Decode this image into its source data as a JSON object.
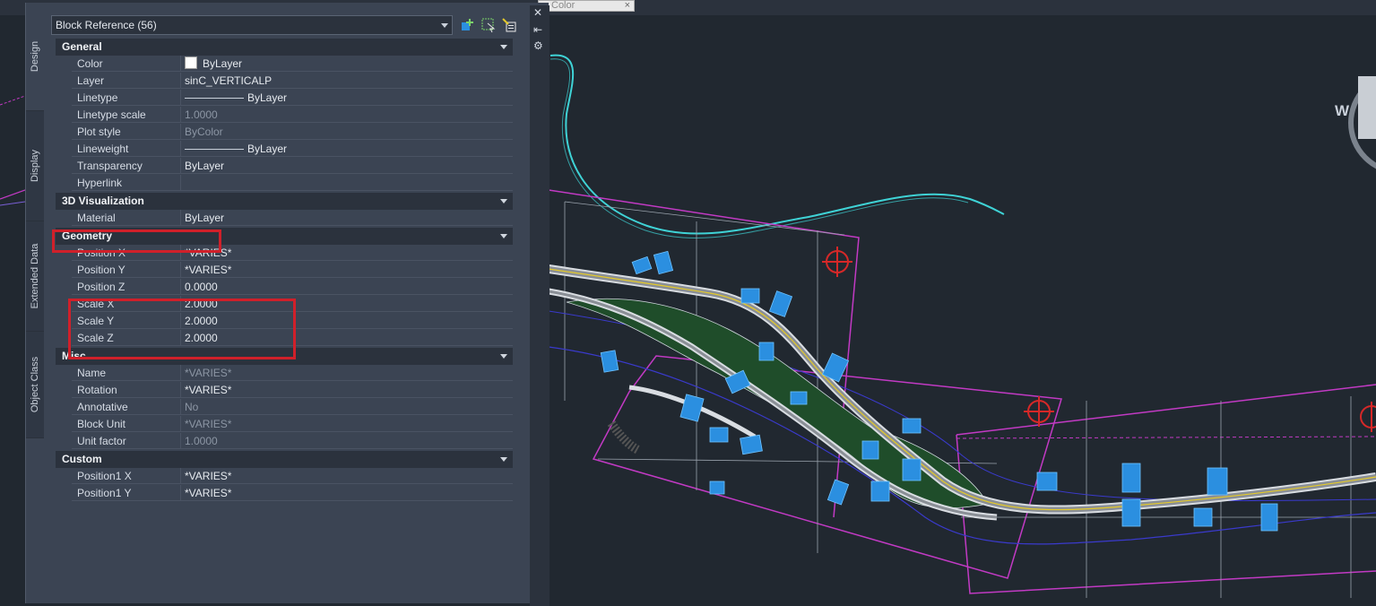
{
  "top": {
    "field_text": "Color",
    "field_clear": "×"
  },
  "palette": {
    "selection": "Block Reference (56)",
    "tabs": [
      "Design",
      "Display",
      "Extended Data",
      "Object Class"
    ],
    "side_buttons": [
      "✕",
      "⇤",
      "⚙"
    ],
    "sections": [
      {
        "title": "General",
        "rows": [
          {
            "name": "Color",
            "value": "ByLayer"
          },
          {
            "name": "Layer",
            "value": "sinC_VERTICALP"
          },
          {
            "name": "Linetype",
            "value": "ByLayer"
          },
          {
            "name": "Linetype scale",
            "value": "1.0000"
          },
          {
            "name": "Plot style",
            "value": "ByColor"
          },
          {
            "name": "Lineweight",
            "value": "ByLayer"
          },
          {
            "name": "Transparency",
            "value": "ByLayer"
          },
          {
            "name": "Hyperlink",
            "value": ""
          }
        ]
      },
      {
        "title": "3D Visualization",
        "rows": [
          {
            "name": "Material",
            "value": "ByLayer"
          }
        ]
      },
      {
        "title": "Geometry",
        "rows": [
          {
            "name": "Position X",
            "value": "*VARIES*"
          },
          {
            "name": "Position Y",
            "value": "*VARIES*"
          },
          {
            "name": "Position Z",
            "value": "0.0000"
          },
          {
            "name": "Scale X",
            "value": "2.0000"
          },
          {
            "name": "Scale Y",
            "value": "2.0000"
          },
          {
            "name": "Scale Z",
            "value": "2.0000"
          }
        ]
      },
      {
        "title": "Misc",
        "rows": [
          {
            "name": "Name",
            "value": "*VARIES*"
          },
          {
            "name": "Rotation",
            "value": "*VARIES*"
          },
          {
            "name": "Annotative",
            "value": "No"
          },
          {
            "name": "Block Unit",
            "value": "*VARIES*"
          },
          {
            "name": "Unit factor",
            "value": "1.0000"
          }
        ]
      },
      {
        "title": "Custom",
        "rows": [
          {
            "name": "Position1 X",
            "value": "*VARIES*"
          },
          {
            "name": "Position1 Y",
            "value": "*VARIES*"
          }
        ]
      }
    ]
  },
  "viewcube": {
    "label": "W"
  },
  "colors": {
    "highlight": "#d0202a",
    "magenta": "#c23ac4",
    "cyan": "#3fd3d6",
    "road_green": "#1f4d2a",
    "building_blue": "#2b8fe0"
  }
}
